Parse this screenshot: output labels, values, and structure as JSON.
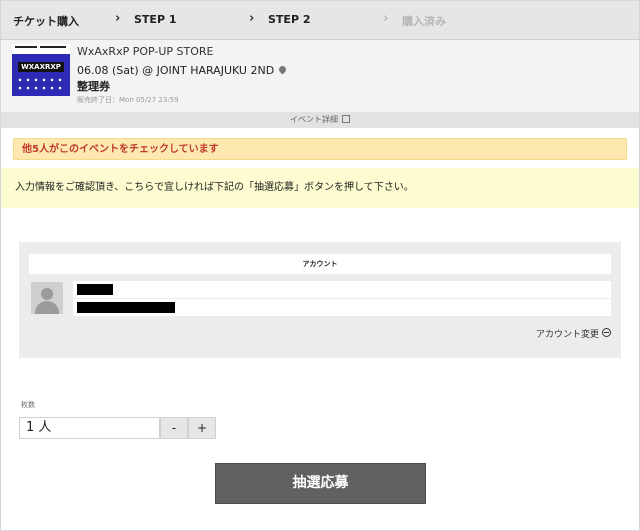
{
  "steps": {
    "items": [
      {
        "label": "チケット購入"
      },
      {
        "label": "STEP 1"
      },
      {
        "label": "STEP 2"
      },
      {
        "label": "購入済み"
      }
    ]
  },
  "event": {
    "thumb_text": "WXAXRXP",
    "title": "WxAxRxP POP-UP STORE",
    "date_venue": "06.08 (Sat) @ JOINT HARAJUKU 2ND",
    "ticket_type": "整理券",
    "sale_end": "販売終了日：Mon 05/27 23:59",
    "detail_link": "イベント詳細"
  },
  "notice": {
    "text": "他5人がこのイベントをチェックしています",
    "color": "#c0392b"
  },
  "info": {
    "text": "入力情報をご確認頂き、こちらで宜しければ下記の「抽選応募」ボタンを押して下さい。"
  },
  "account": {
    "heading": "アカウント",
    "change_label": "アカウント変更"
  },
  "quantity": {
    "label": "枚数",
    "value": "1 人",
    "minus": "-",
    "plus": "+"
  },
  "submit": {
    "label": "抽選応募"
  },
  "colors": {
    "submit_bg": "#616161",
    "notice_bg": "#fde8b0",
    "info_bg": "#fdfbd0",
    "thumb_bg": "#2b2bb3"
  }
}
